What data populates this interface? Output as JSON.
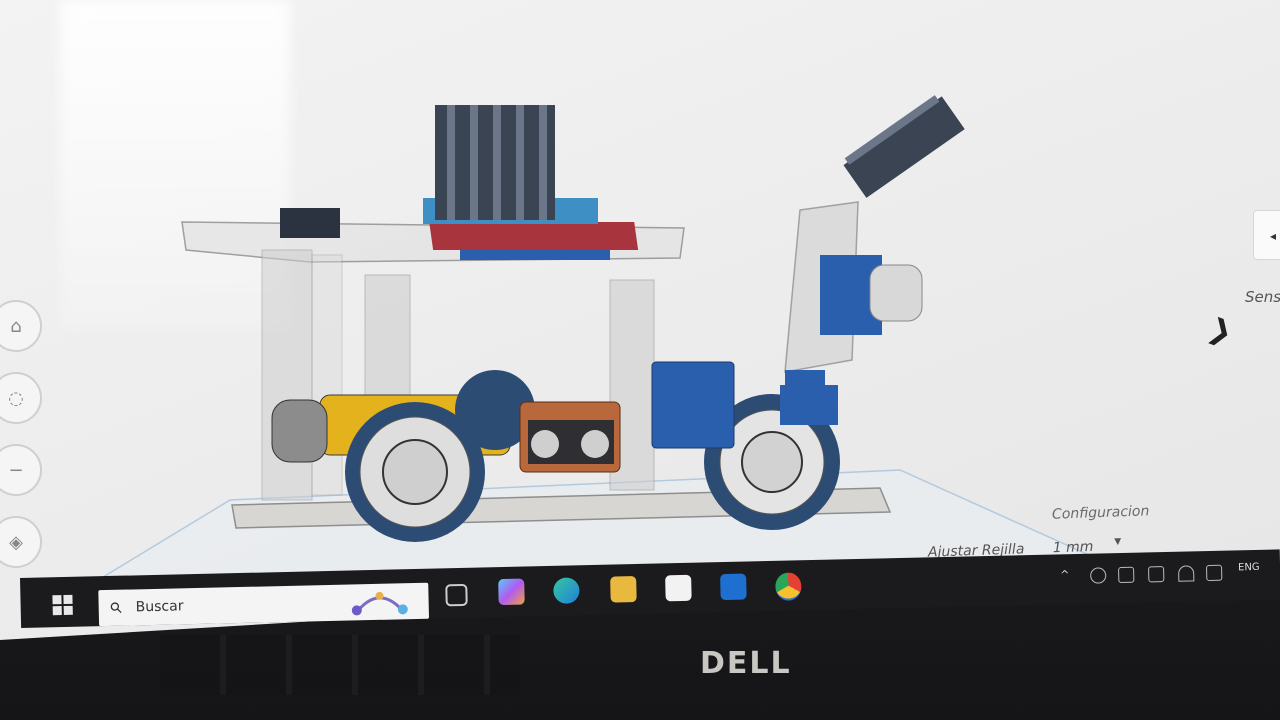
{
  "app": {
    "right_panel": {
      "dropdown_text": "◂",
      "section_label": "Sens",
      "chevron": "❯"
    },
    "config_label": "Configuracion",
    "snap_grid": {
      "label": "Ajustar Rejilla",
      "value": "1 mm"
    }
  },
  "taskbar": {
    "search_placeholder": "Buscar",
    "tray_language": "ENG",
    "accent": "#2f6fd6"
  },
  "device": {
    "brand": "DELL"
  },
  "colors": {
    "chassis": "#c9c9c9",
    "motor_yellow": "#e3b21c",
    "wheel_dark": "#2d4c74",
    "wheel_light": "#dedede",
    "board_red": "#a8343d",
    "board_blue": "#2a5fae",
    "heatsink": "#3b4452",
    "sensor_orange": "#b8683a"
  },
  "icons": [
    "search-icon",
    "windows-start-icon",
    "task-view-icon",
    "copilot-icon",
    "edge-icon",
    "file-explorer-icon",
    "store-icon",
    "outlook-icon",
    "chrome-icon"
  ]
}
